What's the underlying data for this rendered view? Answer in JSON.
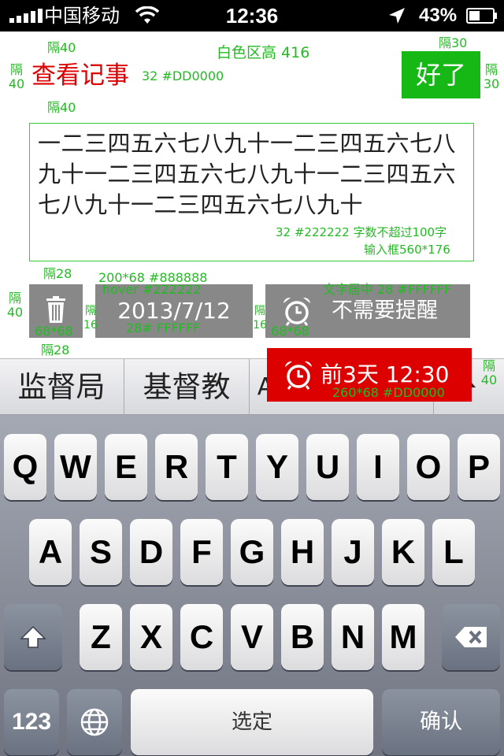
{
  "status_bar": {
    "carrier": "中国移动",
    "time": "12:36",
    "battery_percent": "43%",
    "icons": [
      "signal-icon",
      "wifi-icon",
      "location-arrow-icon",
      "battery-icon"
    ]
  },
  "header": {
    "title": "查看记事",
    "done_label": "好了"
  },
  "note": {
    "content": "一二三四五六七八九十一二三四五六七八九十一二三四五六七八九十一二三四五六七八九十一二三四五六七八九十"
  },
  "toolbar": {
    "date_label": "2013/7/12",
    "remind_label": "不需要提醒",
    "icons": [
      "trash-icon",
      "alarm-clock-icon"
    ]
  },
  "reminder": {
    "label": "前3天 12:30"
  },
  "candidates": {
    "items": [
      "监督局",
      "基督教",
      "A"
    ]
  },
  "keyboard": {
    "row1": [
      "Q",
      "W",
      "E",
      "R",
      "T",
      "Y",
      "U",
      "I",
      "O",
      "P"
    ],
    "row2": [
      "A",
      "S",
      "D",
      "F",
      "G",
      "H",
      "J",
      "K",
      "L"
    ],
    "row3": [
      "Z",
      "X",
      "C",
      "V",
      "B",
      "N",
      "M"
    ],
    "num_label": "123",
    "space_label": "选定",
    "confirm_label": "确认"
  },
  "annotations": {
    "gap40_top": "隔40",
    "white_area": "白色区高 416",
    "gap30_top": "隔30",
    "gap40_left": "隔40",
    "title_spec": "32 #DD0000",
    "gap30_right": "隔30",
    "gap40_mid": "隔40",
    "text_spec": "32 #222222 字数不超过100字",
    "input_box": "输入框560*176",
    "gap28_top": "隔28",
    "btn_spec": "200*68 #888888",
    "hover_spec": "hover #222222",
    "text_center": "文字居中 28 #FFFFFF",
    "gap40_left2": "隔40",
    "gap16_a": "隔16",
    "gap16_b": "隔16",
    "trash_size": "68*68",
    "date_text_spec": "28# FFFFFF",
    "alarm_size": "68*68",
    "gap28_bottom": "隔28",
    "gap40_right2": "隔40",
    "red_spec": "260*68 #DD0000"
  },
  "colors": {
    "title": "#DD0000",
    "done_button": "#16B816",
    "button_gray": "#888888",
    "reminder_red": "#DD0000",
    "annotation": "#22BB22"
  }
}
